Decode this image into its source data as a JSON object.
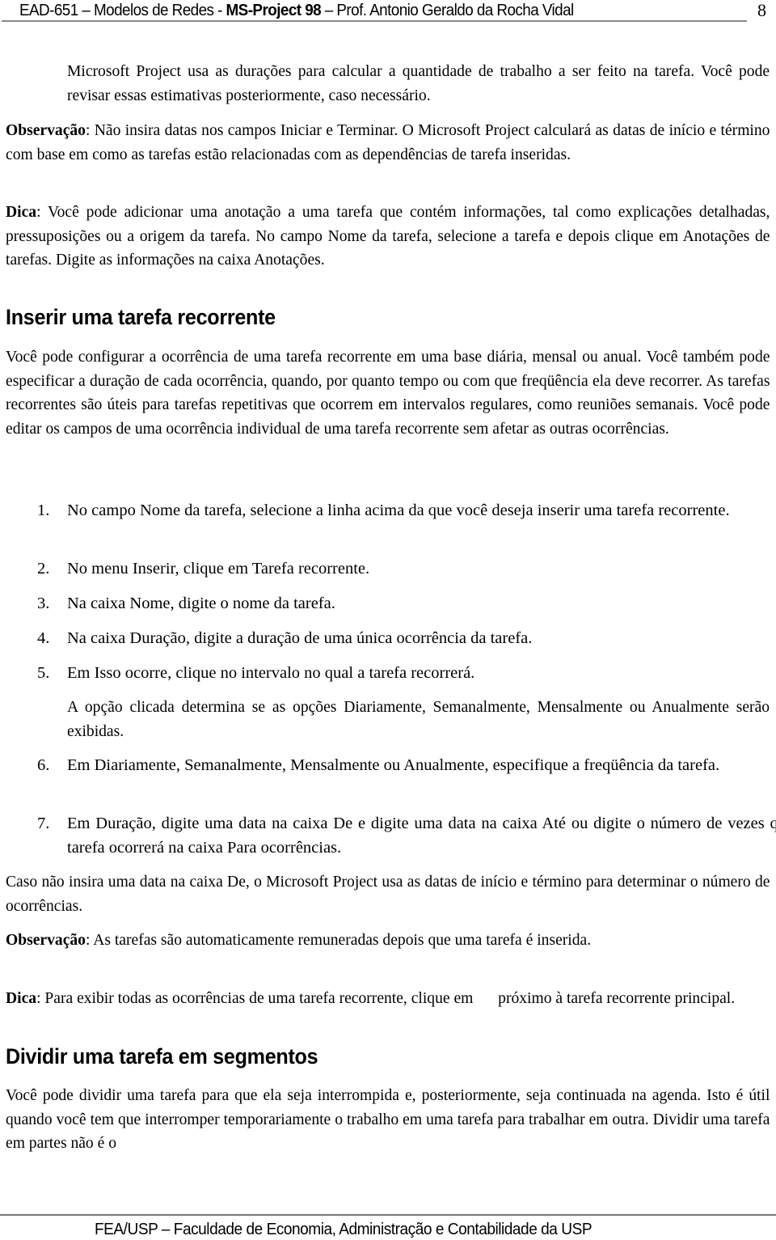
{
  "header": {
    "title_pre": "EAD-651 – Modelos de Redes - ",
    "title_bold": "MS-Project 98",
    "title_post": " – Prof. Antonio Geraldo da Rocha Vidal",
    "page_number": "8"
  },
  "intro": {
    "note_text": "Microsoft Project usa as durações para calcular a quantidade de trabalho a ser feito na tarefa. Você pode revisar essas estimativas posteriormente, caso necessário.",
    "obs_label": "Observação",
    "obs_text": ": Não insira datas nos campos Iniciar e Terminar. O Microsoft Project calculará as datas de início e término com base em como as tarefas estão relacionadas com as dependências de tarefa inseridas.",
    "tip_label": "Dica",
    "tip_text": ": Você pode adicionar uma anotação a uma tarefa que contém informações, tal como explicações detalhadas, pressuposições ou a origem da tarefa. No campo Nome da tarefa, selecione a tarefa e depois clique em Anotações de tarefas. Digite as informações na caixa Anotações."
  },
  "section1": {
    "heading": "Inserir uma tarefa recorrente",
    "paragraph": "Você pode configurar a ocorrência de uma tarefa recorrente em uma base diária, mensal ou anual. Você também pode especificar a duração de cada ocorrência, quando, por quanto tempo ou com que freqüência ela deve recorrer. As tarefas recorrentes são úteis para tarefas repetitivas que ocorrem em intervalos regulares, como reuniões semanais. Você pode editar os campos de uma ocorrência individual de uma tarefa recorrente sem afetar as outras ocorrências.",
    "steps": [
      {
        "num": "1.",
        "text": "No campo Nome da tarefa, selecione a linha acima da que você deseja inserir uma tarefa recorrente."
      },
      {
        "num": "2.",
        "text": "No menu Inserir, clique em Tarefa recorrente."
      },
      {
        "num": "3.",
        "text": "Na caixa Nome, digite o nome da tarefa."
      },
      {
        "num": "4.",
        "text": "Na caixa Duração, digite a duração de uma única ocorrência da tarefa."
      },
      {
        "num": "5.",
        "text": "Em Isso ocorre, clique no intervalo no qual a tarefa recorrerá."
      },
      {
        "num": "6.",
        "text": "Em Diariamente, Semanalmente, Mensalmente ou Anualmente, especifique a freqüência da tarefa."
      },
      {
        "num": "7.",
        "text": "Em Duração, digite uma data na caixa De e digite uma data na caixa Até ou digite o número de vezes que a tarefa ocorrerá na caixa Para ocorrências."
      }
    ],
    "step5_note": "A opção clicada determina se as opções Diariamente, Semanalmente, Mensalmente ou Anualmente serão exibidas.",
    "after_steps": "Caso não insira uma data na caixa De, o Microsoft Project usa as datas de início e término para determinar o número de ocorrências.",
    "obs_label": "Observação",
    "obs_text": ": As tarefas são automaticamente remuneradas depois que uma tarefa é inserida.",
    "tip_label": "Dica",
    "tip_text_a": ": Para exibir todas as ocorrências de uma tarefa recorrente, clique em ",
    "tip_text_b": " próximo à tarefa recorrente principal."
  },
  "section2": {
    "heading": "Dividir uma tarefa em segmentos",
    "paragraph": "Você pode dividir uma tarefa para que ela seja interrompida e, posteriormente, seja continuada na agenda. Isto é útil quando você tem que interromper temporariamente o trabalho em uma tarefa para trabalhar em outra. Dividir uma tarefa em partes não é o"
  },
  "footer": {
    "text": "FEA/USP – Faculdade de Economia, Administração e Contabilidade da USP"
  }
}
